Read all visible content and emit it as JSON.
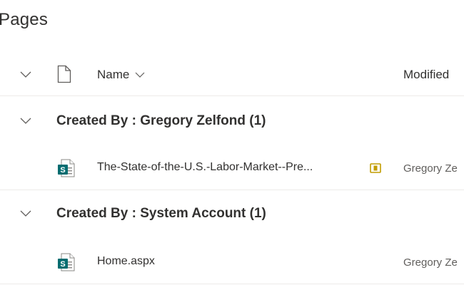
{
  "page": {
    "title": "Pages"
  },
  "header": {
    "name_label": "Name",
    "modified_label": "Modified"
  },
  "groups": [
    {
      "label": "Created By : Gregory Zelfond (1)",
      "items": [
        {
          "name": "The-State-of-the-U.S.-Labor-Market--Pre...",
          "modified_by": "Gregory Ze",
          "checked_out": true
        }
      ]
    },
    {
      "label": "Created By : System Account (1)",
      "items": [
        {
          "name": "Home.aspx",
          "modified_by": "Gregory Ze",
          "checked_out": false
        }
      ]
    }
  ],
  "colors": {
    "sharepoint_teal": "#036c70",
    "checkout_gold": "#c19c00",
    "divider": "#edebe9",
    "text_primary": "#323130",
    "text_secondary": "#605e5c"
  },
  "icons": {
    "collapse": "chevron-down-icon",
    "file_type_header": "document-icon",
    "sort": "chevron-down-icon",
    "page_file": "sharepoint-page-icon",
    "checked_out": "checked-out-icon"
  }
}
